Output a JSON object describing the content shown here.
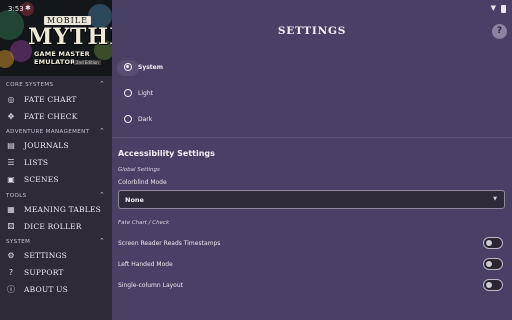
{
  "status_bar": {
    "time": "3:53",
    "gear_icon": "gear-icon",
    "wifi_icon": "wifi-icon",
    "battery_icon": "battery-icon"
  },
  "logo": {
    "top_word": "MOBILE",
    "main_word": "MYTHIC",
    "sub_word": "GAME MASTER EMULATOR",
    "edition": "2nd Edition"
  },
  "sidebar": {
    "sections": [
      {
        "title": "CORE SYSTEMS",
        "items": [
          {
            "label": "FATE CHART",
            "icon": "chart-icon"
          },
          {
            "label": "FATE CHECK",
            "icon": "dice-icon"
          }
        ]
      },
      {
        "title": "ADVENTURE MANAGEMENT",
        "items": [
          {
            "label": "JOURNALS",
            "icon": "journal-icon"
          },
          {
            "label": "LISTS",
            "icon": "list-icon"
          },
          {
            "label": "SCENES",
            "icon": "scenes-icon"
          }
        ]
      },
      {
        "title": "TOOLS",
        "items": [
          {
            "label": "MEANING TABLES",
            "icon": "table-icon"
          },
          {
            "label": "DICE ROLLER",
            "icon": "dice-icon"
          }
        ]
      },
      {
        "title": "SYSTEM",
        "items": [
          {
            "label": "SETTINGS",
            "icon": "gear-icon"
          },
          {
            "label": "SUPPORT",
            "icon": "help-icon"
          },
          {
            "label": "ABOUT US",
            "icon": "info-icon"
          }
        ]
      }
    ]
  },
  "main": {
    "title": "SETTINGS",
    "help_icon": "?",
    "theme_options": [
      {
        "label": "System",
        "selected": true
      },
      {
        "label": "Light",
        "selected": false
      },
      {
        "label": "Dark",
        "selected": false
      }
    ],
    "accessibility": {
      "heading": "Accessibility Settings",
      "global_heading": "Global Settings",
      "colorblind_label": "Colorblind Mode",
      "colorblind_value": "None",
      "fate_heading": "Fate Chart / Check",
      "toggles": [
        {
          "label": "Screen Reader Reads Timestamps",
          "on": false
        },
        {
          "label": "Left Handed Mode",
          "on": false
        },
        {
          "label": "Single-column Layout",
          "on": false
        }
      ]
    }
  }
}
